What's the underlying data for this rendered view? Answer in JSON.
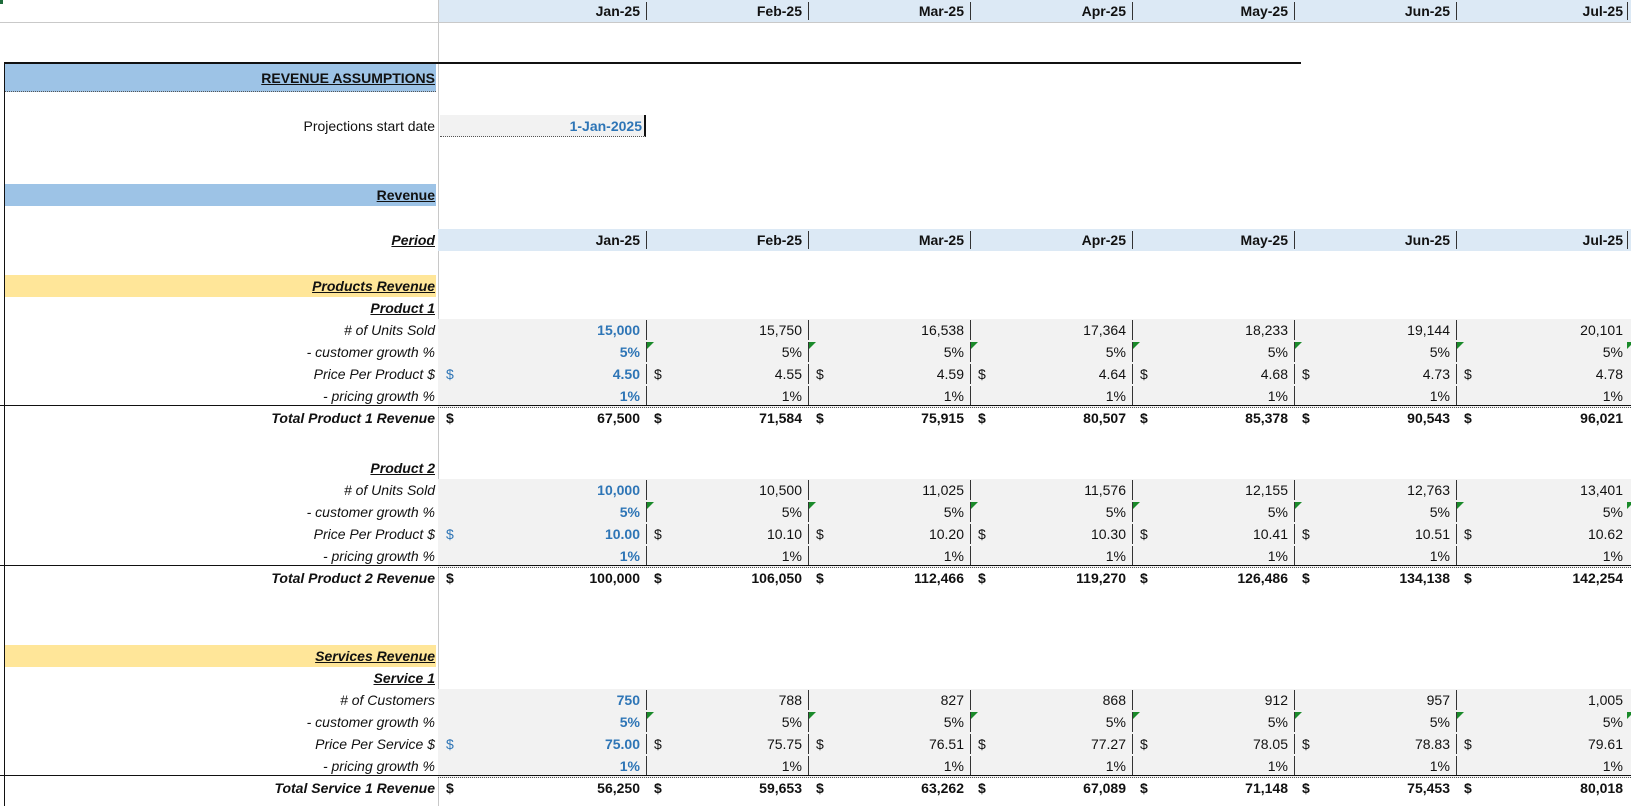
{
  "months": [
    "Jan-25",
    "Feb-25",
    "Mar-25",
    "Apr-25",
    "May-25",
    "Jun-25",
    "Jul-25"
  ],
  "section_title": "REVENUE ASSUMPTIONS",
  "start_date": {
    "label": "Projections  start date",
    "value": "1-Jan-2025"
  },
  "revenue_title": "Revenue",
  "period_label": "Period",
  "products_revenue_label": "Products Revenue",
  "services_revenue_label": "Services Revenue",
  "currency": "$",
  "product1": {
    "title": "Product 1",
    "units_label": "# of Units Sold",
    "units": [
      "15,000",
      "15,750",
      "16,538",
      "17,364",
      "18,233",
      "19,144",
      "20,101"
    ],
    "cust_growth_label": "- customer growth %",
    "cust_growth": [
      "5%",
      "5%",
      "5%",
      "5%",
      "5%",
      "5%",
      "5%"
    ],
    "price_label": "Price Per Product $",
    "price": [
      "4.50",
      "4.55",
      "4.59",
      "4.64",
      "4.68",
      "4.73",
      "4.78"
    ],
    "price_growth_label": "- pricing growth %",
    "price_growth": [
      "1%",
      "1%",
      "1%",
      "1%",
      "1%",
      "1%",
      "1%"
    ],
    "total_label": "Total Product 1 Revenue",
    "total": [
      "67,500",
      "71,584",
      "75,915",
      "80,507",
      "85,378",
      "90,543",
      "96,021"
    ]
  },
  "product2": {
    "title": "Product 2",
    "units_label": "# of Units Sold",
    "units": [
      "10,000",
      "10,500",
      "11,025",
      "11,576",
      "12,155",
      "12,763",
      "13,401"
    ],
    "cust_growth_label": "- customer growth %",
    "cust_growth": [
      "5%",
      "5%",
      "5%",
      "5%",
      "5%",
      "5%",
      "5%"
    ],
    "price_label": "Price Per Product $",
    "price": [
      "10.00",
      "10.10",
      "10.20",
      "10.30",
      "10.41",
      "10.51",
      "10.62"
    ],
    "price_growth_label": "- pricing growth %",
    "price_growth": [
      "1%",
      "1%",
      "1%",
      "1%",
      "1%",
      "1%",
      "1%"
    ],
    "total_label": "Total Product 2 Revenue",
    "total": [
      "100,000",
      "106,050",
      "112,466",
      "119,270",
      "126,486",
      "134,138",
      "142,254"
    ]
  },
  "service1": {
    "title": "Service 1",
    "units_label": "# of Customers",
    "units": [
      "750",
      "788",
      "827",
      "868",
      "912",
      "957",
      "1,005"
    ],
    "cust_growth_label": "- customer growth %",
    "cust_growth": [
      "5%",
      "5%",
      "5%",
      "5%",
      "5%",
      "5%",
      "5%"
    ],
    "price_label": "Price Per Service $",
    "price": [
      "75.00",
      "75.75",
      "76.51",
      "77.27",
      "78.05",
      "78.83",
      "79.61"
    ],
    "price_growth_label": "- pricing growth %",
    "price_growth": [
      "1%",
      "1%",
      "1%",
      "1%",
      "1%",
      "1%",
      "1%"
    ],
    "total_label": "Total Service 1 Revenue",
    "total": [
      "56,250",
      "59,653",
      "63,262",
      "67,089",
      "71,148",
      "75,453",
      "80,018"
    ]
  },
  "colors": {
    "header_band": "#dce9f5",
    "section_band": "#9dc3e6",
    "yellow_band": "#ffe699",
    "input_blue": "#2e75b6",
    "flag_green": "#1a8a2a"
  }
}
